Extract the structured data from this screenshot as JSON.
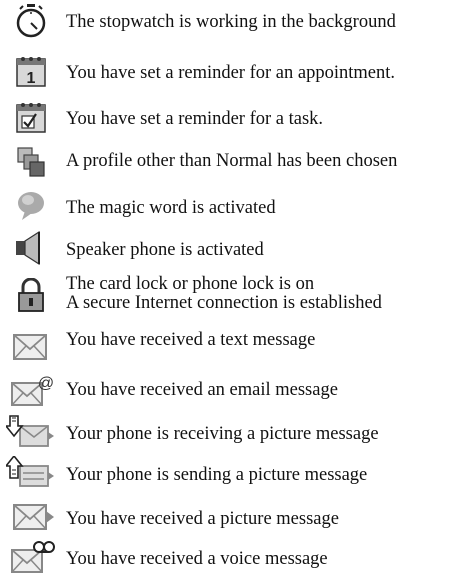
{
  "items": [
    {
      "icon": "stopwatch-icon",
      "text": "The stopwatch is working in the background"
    },
    {
      "icon": "calendar-appointment-icon",
      "text": "You have set a reminder for an appointment."
    },
    {
      "icon": "calendar-task-icon",
      "text": "You have set a reminder for a task."
    },
    {
      "icon": "profile-icon",
      "text": "A profile other than Normal has been chosen"
    },
    {
      "icon": "magic-word-icon",
      "text": "The magic word is activated"
    },
    {
      "icon": "speaker-icon",
      "text": "Speaker phone is activated"
    },
    {
      "icon": "lock-icon",
      "text": "The card lock or phone lock is on",
      "text2": "A secure Internet connection is established"
    },
    {
      "icon": "text-message-icon",
      "text": "You have received a text message"
    },
    {
      "icon": "email-message-icon",
      "text": "You have received an email message"
    },
    {
      "icon": "picture-receiving-icon",
      "text": "Your phone is receiving a picture message"
    },
    {
      "icon": "picture-sending-icon",
      "text": "Your phone is sending a picture message"
    },
    {
      "icon": "picture-message-icon",
      "text": "You have received a picture message"
    },
    {
      "icon": "voice-message-icon",
      "text": "You have received a voice message"
    }
  ]
}
